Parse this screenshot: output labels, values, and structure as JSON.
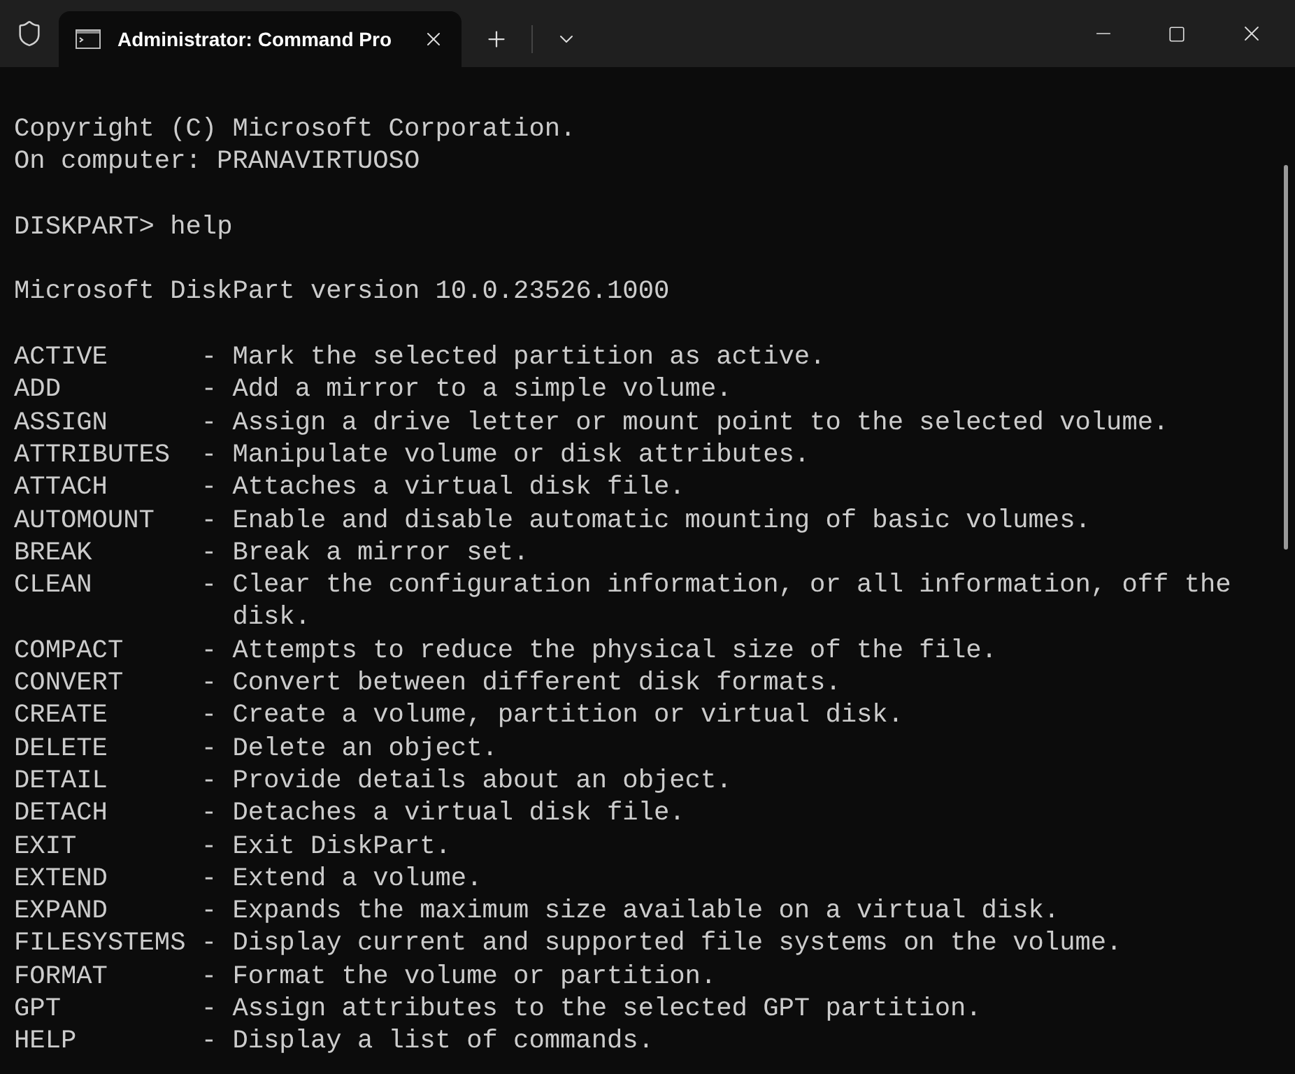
{
  "tab": {
    "title": "Administrator: Command Pro",
    "selected": true
  },
  "header_lines": [
    "Copyright (C) Microsoft Corporation.",
    "On computer: PRANAVIRTUOSO"
  ],
  "prompt": {
    "prompt": "DISKPART>",
    "command": "help"
  },
  "version_line": "Microsoft DiskPart version 10.0.23526.1000",
  "commands": [
    {
      "name": "ACTIVE",
      "dash": "-",
      "description": "Mark the selected partition as active."
    },
    {
      "name": "ADD",
      "dash": "-",
      "description": "Add a mirror to a simple volume."
    },
    {
      "name": "ASSIGN",
      "dash": "-",
      "description": "Assign a drive letter or mount point to the selected volume."
    },
    {
      "name": "ATTRIBUTES",
      "dash": "-",
      "description": "Manipulate volume or disk attributes."
    },
    {
      "name": "ATTACH",
      "dash": "-",
      "description": "Attaches a virtual disk file."
    },
    {
      "name": "AUTOMOUNT",
      "dash": "-",
      "description": "Enable and disable automatic mounting of basic volumes."
    },
    {
      "name": "BREAK",
      "dash": "-",
      "description": "Break a mirror set."
    },
    {
      "name": "CLEAN",
      "dash": "-",
      "description": "Clear the configuration information, or all information, off the disk."
    },
    {
      "name": "COMPACT",
      "dash": "-",
      "description": "Attempts to reduce the physical size of the file."
    },
    {
      "name": "CONVERT",
      "dash": "-",
      "description": "Convert between different disk formats."
    },
    {
      "name": "CREATE",
      "dash": "-",
      "description": "Create a volume, partition or virtual disk."
    },
    {
      "name": "DELETE",
      "dash": "-",
      "description": "Delete an object."
    },
    {
      "name": "DETAIL",
      "dash": "-",
      "description": "Provide details about an object."
    },
    {
      "name": "DETACH",
      "dash": "-",
      "description": "Detaches a virtual disk file."
    },
    {
      "name": "EXIT",
      "dash": "-",
      "description": "Exit DiskPart."
    },
    {
      "name": "EXTEND",
      "dash": "-",
      "description": "Extend a volume."
    },
    {
      "name": "EXPAND",
      "dash": "-",
      "description": "Expands the maximum size available on a virtual disk."
    },
    {
      "name": "FILESYSTEMS",
      "dash": "-",
      "description": "Display current and supported file systems on the volume."
    },
    {
      "name": "FORMAT",
      "dash": "-",
      "description": "Format the volume or partition."
    },
    {
      "name": "GPT",
      "dash": "-",
      "description": "Assign attributes to the selected GPT partition."
    },
    {
      "name": "HELP",
      "dash": "-",
      "description": "Display a list of commands."
    }
  ]
}
